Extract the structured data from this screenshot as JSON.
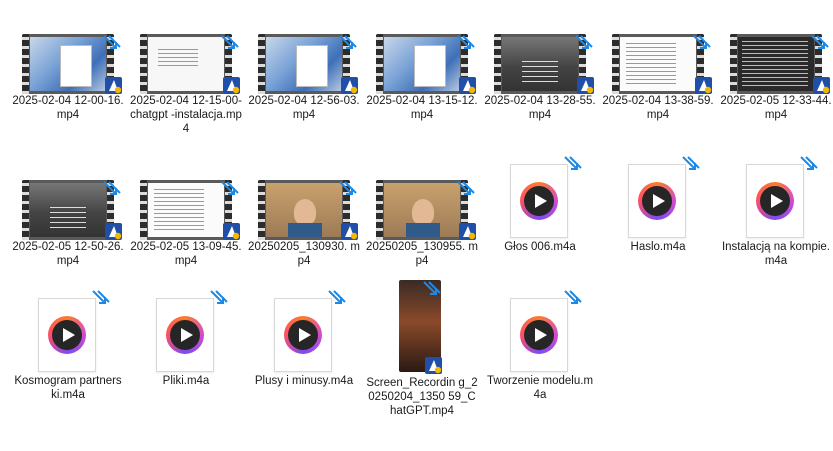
{
  "files": [
    {
      "kind": "video",
      "thumb": "blue",
      "icon": "video-thumbnail",
      "label": "2025-02-04 12-00-16.mp4"
    },
    {
      "kind": "video",
      "thumb": "white",
      "icon": "video-thumbnail",
      "label": "2025-02-04 12-15-00-chatgpt -instalacja.mp4"
    },
    {
      "kind": "video",
      "thumb": "blue",
      "icon": "video-thumbnail",
      "label": "2025-02-04 12-56-03.mp4"
    },
    {
      "kind": "video",
      "thumb": "blue",
      "icon": "video-thumbnail",
      "label": "2025-02-04 13-15-12.mp4"
    },
    {
      "kind": "video",
      "thumb": "dark",
      "icon": "video-thumbnail",
      "label": "2025-02-04 13-28-55.mp4"
    },
    {
      "kind": "video",
      "thumb": "code",
      "icon": "video-thumbnail",
      "label": "2025-02-04 13-38-59.mp4"
    },
    {
      "kind": "video",
      "thumb": "term",
      "icon": "video-thumbnail",
      "label": "2025-02-05 12-33-44.mp4"
    },
    {
      "kind": "video",
      "thumb": "dark",
      "icon": "video-thumbnail",
      "label": "2025-02-05 12-50-26.mp4"
    },
    {
      "kind": "video",
      "thumb": "code",
      "icon": "video-thumbnail",
      "label": "2025-02-05 13-09-45.mp4"
    },
    {
      "kind": "video",
      "thumb": "person",
      "icon": "video-thumbnail",
      "label": "20250205_130930. mp4"
    },
    {
      "kind": "video",
      "thumb": "person",
      "icon": "video-thumbnail",
      "label": "20250205_130955. mp4"
    },
    {
      "kind": "audio",
      "icon": "audio-file-icon",
      "label": "Głos 006.m4a"
    },
    {
      "kind": "audio",
      "icon": "audio-file-icon",
      "label": "Haslo.m4a"
    },
    {
      "kind": "audio",
      "icon": "audio-file-icon",
      "label": "Instalacją na kompie.m4a"
    },
    {
      "kind": "audio",
      "icon": "audio-file-icon",
      "label": "Kosmogram partnerski.m4a"
    },
    {
      "kind": "audio",
      "icon": "audio-file-icon",
      "label": "Pliki.m4a"
    },
    {
      "kind": "audio",
      "icon": "audio-file-icon",
      "label": "Plusy i minusy.m4a"
    },
    {
      "kind": "phone",
      "icon": "video-thumbnail",
      "label": "Screen_Recordin g_20250204_1350 59_ChatGPT.mp4"
    },
    {
      "kind": "audio",
      "icon": "audio-file-icon",
      "label": "Tworzenie modelu.m4a"
    }
  ]
}
